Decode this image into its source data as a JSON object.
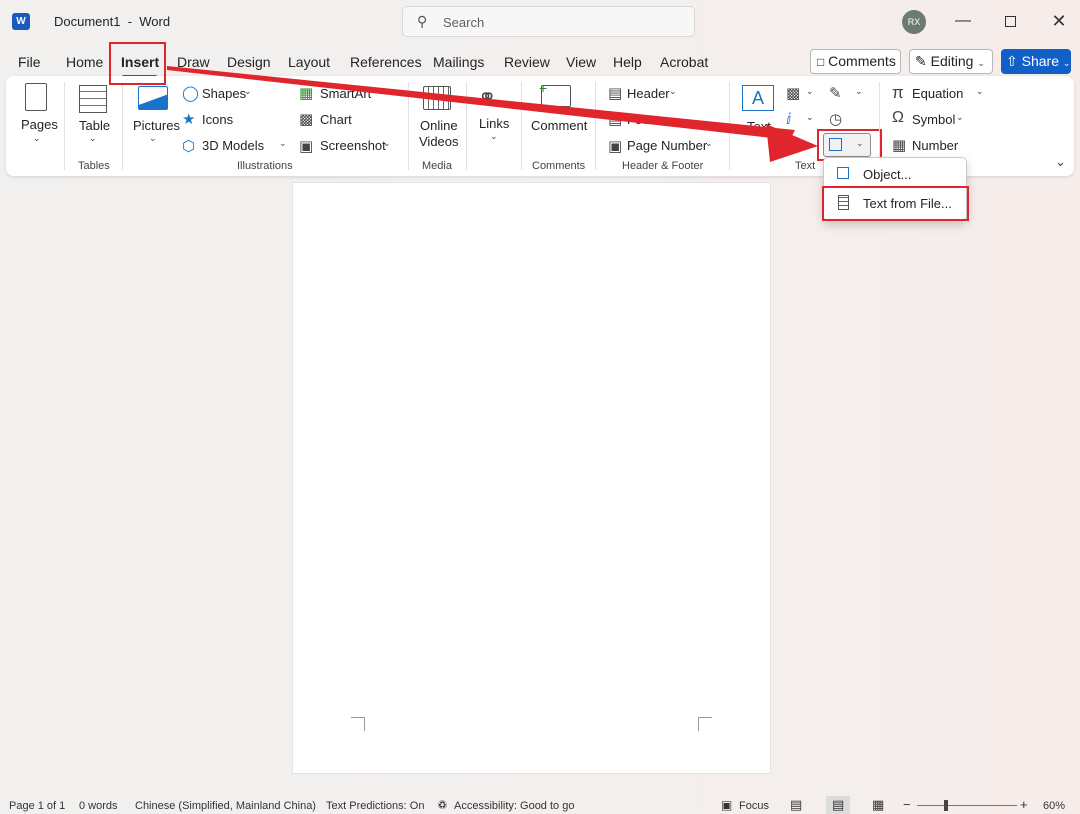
{
  "titlebar": {
    "app_title": "Document1  -  Word",
    "logo": "W",
    "search_placeholder": "Search",
    "avatar": "RX"
  },
  "menu": {
    "tabs": [
      "File",
      "Home",
      "Insert",
      "Draw",
      "Design",
      "Layout",
      "References",
      "Mailings",
      "Review",
      "View",
      "Help",
      "Acrobat"
    ],
    "comments_label": "Comments",
    "editing_label": "Editing",
    "share_label": "Share"
  },
  "ribbon": {
    "pages": "Pages",
    "table": "Table",
    "pictures": "Pictures",
    "shapes": "Shapes",
    "icons": "Icons",
    "models3d": "3D Models",
    "smartart": "SmartArt",
    "chart": "Chart",
    "screenshot": "Screenshot",
    "online_videos_1": "Online",
    "online_videos_2": "Videos",
    "links": "Links",
    "comment": "Comment",
    "header": "Header",
    "footer": "Footer",
    "page_number": "Page Number",
    "text": "Text",
    "equation": "Equation",
    "symbol": "Symbol",
    "number": "Number",
    "groups": {
      "tables": "Tables",
      "illustrations": "Illustrations",
      "media": "Media",
      "comments": "Comments",
      "header_footer": "Header & Footer",
      "text": "Text"
    }
  },
  "dropdown": {
    "object": "Object...",
    "text_from_file": "Text from File..."
  },
  "statusbar": {
    "page": "Page 1 of 1",
    "words": "0 words",
    "language": "Chinese (Simplified, Mainland China)",
    "predictions": "Text Predictions: On",
    "accessibility": "Accessibility: Good to go",
    "focus": "Focus",
    "zoom": "60%"
  },
  "colors": {
    "accent": "#185abd",
    "highlight": "#e0252d",
    "share": "#1160c8"
  }
}
